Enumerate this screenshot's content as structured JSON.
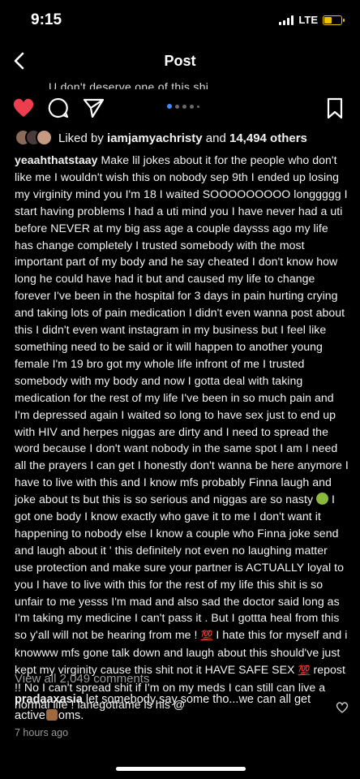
{
  "status_bar": {
    "time": "9:15",
    "network": "LTE"
  },
  "nav": {
    "title": "Post"
  },
  "image_strip_text": "U don't deserve one of this shi",
  "carousel": {
    "count": 5,
    "active_index": 0
  },
  "likes": {
    "prefix": "Liked by ",
    "user": "iamjamyachristy",
    "middle": " and ",
    "count": "14,494 others"
  },
  "caption": {
    "username": "yeaahthatstaay",
    "part1": " Make lil jokes about it for the people who don't like me I wouldn't wish this on nobody sep 9th I ended up losing my virginity mind you I'm 18 I waited SOOOOOOOOO longgggg I start having problems I had a uti mind you I have never had a uti before NEVER at my big ass age a couple daysss ago my life has change completely I trusted somebody with the most important part of my body and he say cheated I don't know how long he could have had it but  and caused my life to change forever I've been in the hospital for 3 days in pain hurting crying and taking lots of pain medication I didn't even wanna post about this I didn't even want instagram in my business but I feel like something need to be said or it will happen to another young female I'm 19 bro got my whole life infront of me I trusted somebody with my body and now I gotta deal with taking medication for the rest of my life I've been in so much pain and I'm depressed again I waited so long to have sex just to end up with HIV and herpes niggas are dirty and I need to spread the word because I don't  want nobody in the same spot I am I need all the prayers I can get I honestly don't wanna be here anymore I have to live with this and I know mfs probably Finna laugh and joke about ts but this is so serious and niggas are so nasty ",
    "part2": " I got one body I know exactly who gave it to me I don't want it happening to nobody else I know a couple who Finna joke send and laugh about it ' this definitely not even no laughing matter use protection and make sure your partner is ACTUALLY loyal to you I have to live with this for the rest of my life this shit is so unfair to me yesss I'm mad and also sad the doctor said long as I'm taking my medicine I can't pass it . But I gottta heal from this so y'all will not be hearing from me ! ",
    "part3": " I hate this for myself and i knowww mfs gone talk down and laugh about this should've just kept my virginity cause this shit not it HAVE SAFE SEX ",
    "part4": " repost !! No I can't spread shit if I'm on my meds I can still can live a normal life ! lanegotfame is his @",
    "emoji_hundred": "💯"
  },
  "view_comments": "View all 2,049 comments",
  "comment": {
    "username": "pradaaxasia",
    "text_before": " let somebody say some tho...we can all get active",
    "text_after": "oms."
  },
  "timestamp": "7 hours ago",
  "colors": {
    "like_red": "#ed3e4f",
    "carousel_blue": "#3a8dff",
    "battery_yellow": "#e6c200",
    "muted_text": "#9a9a9a"
  }
}
